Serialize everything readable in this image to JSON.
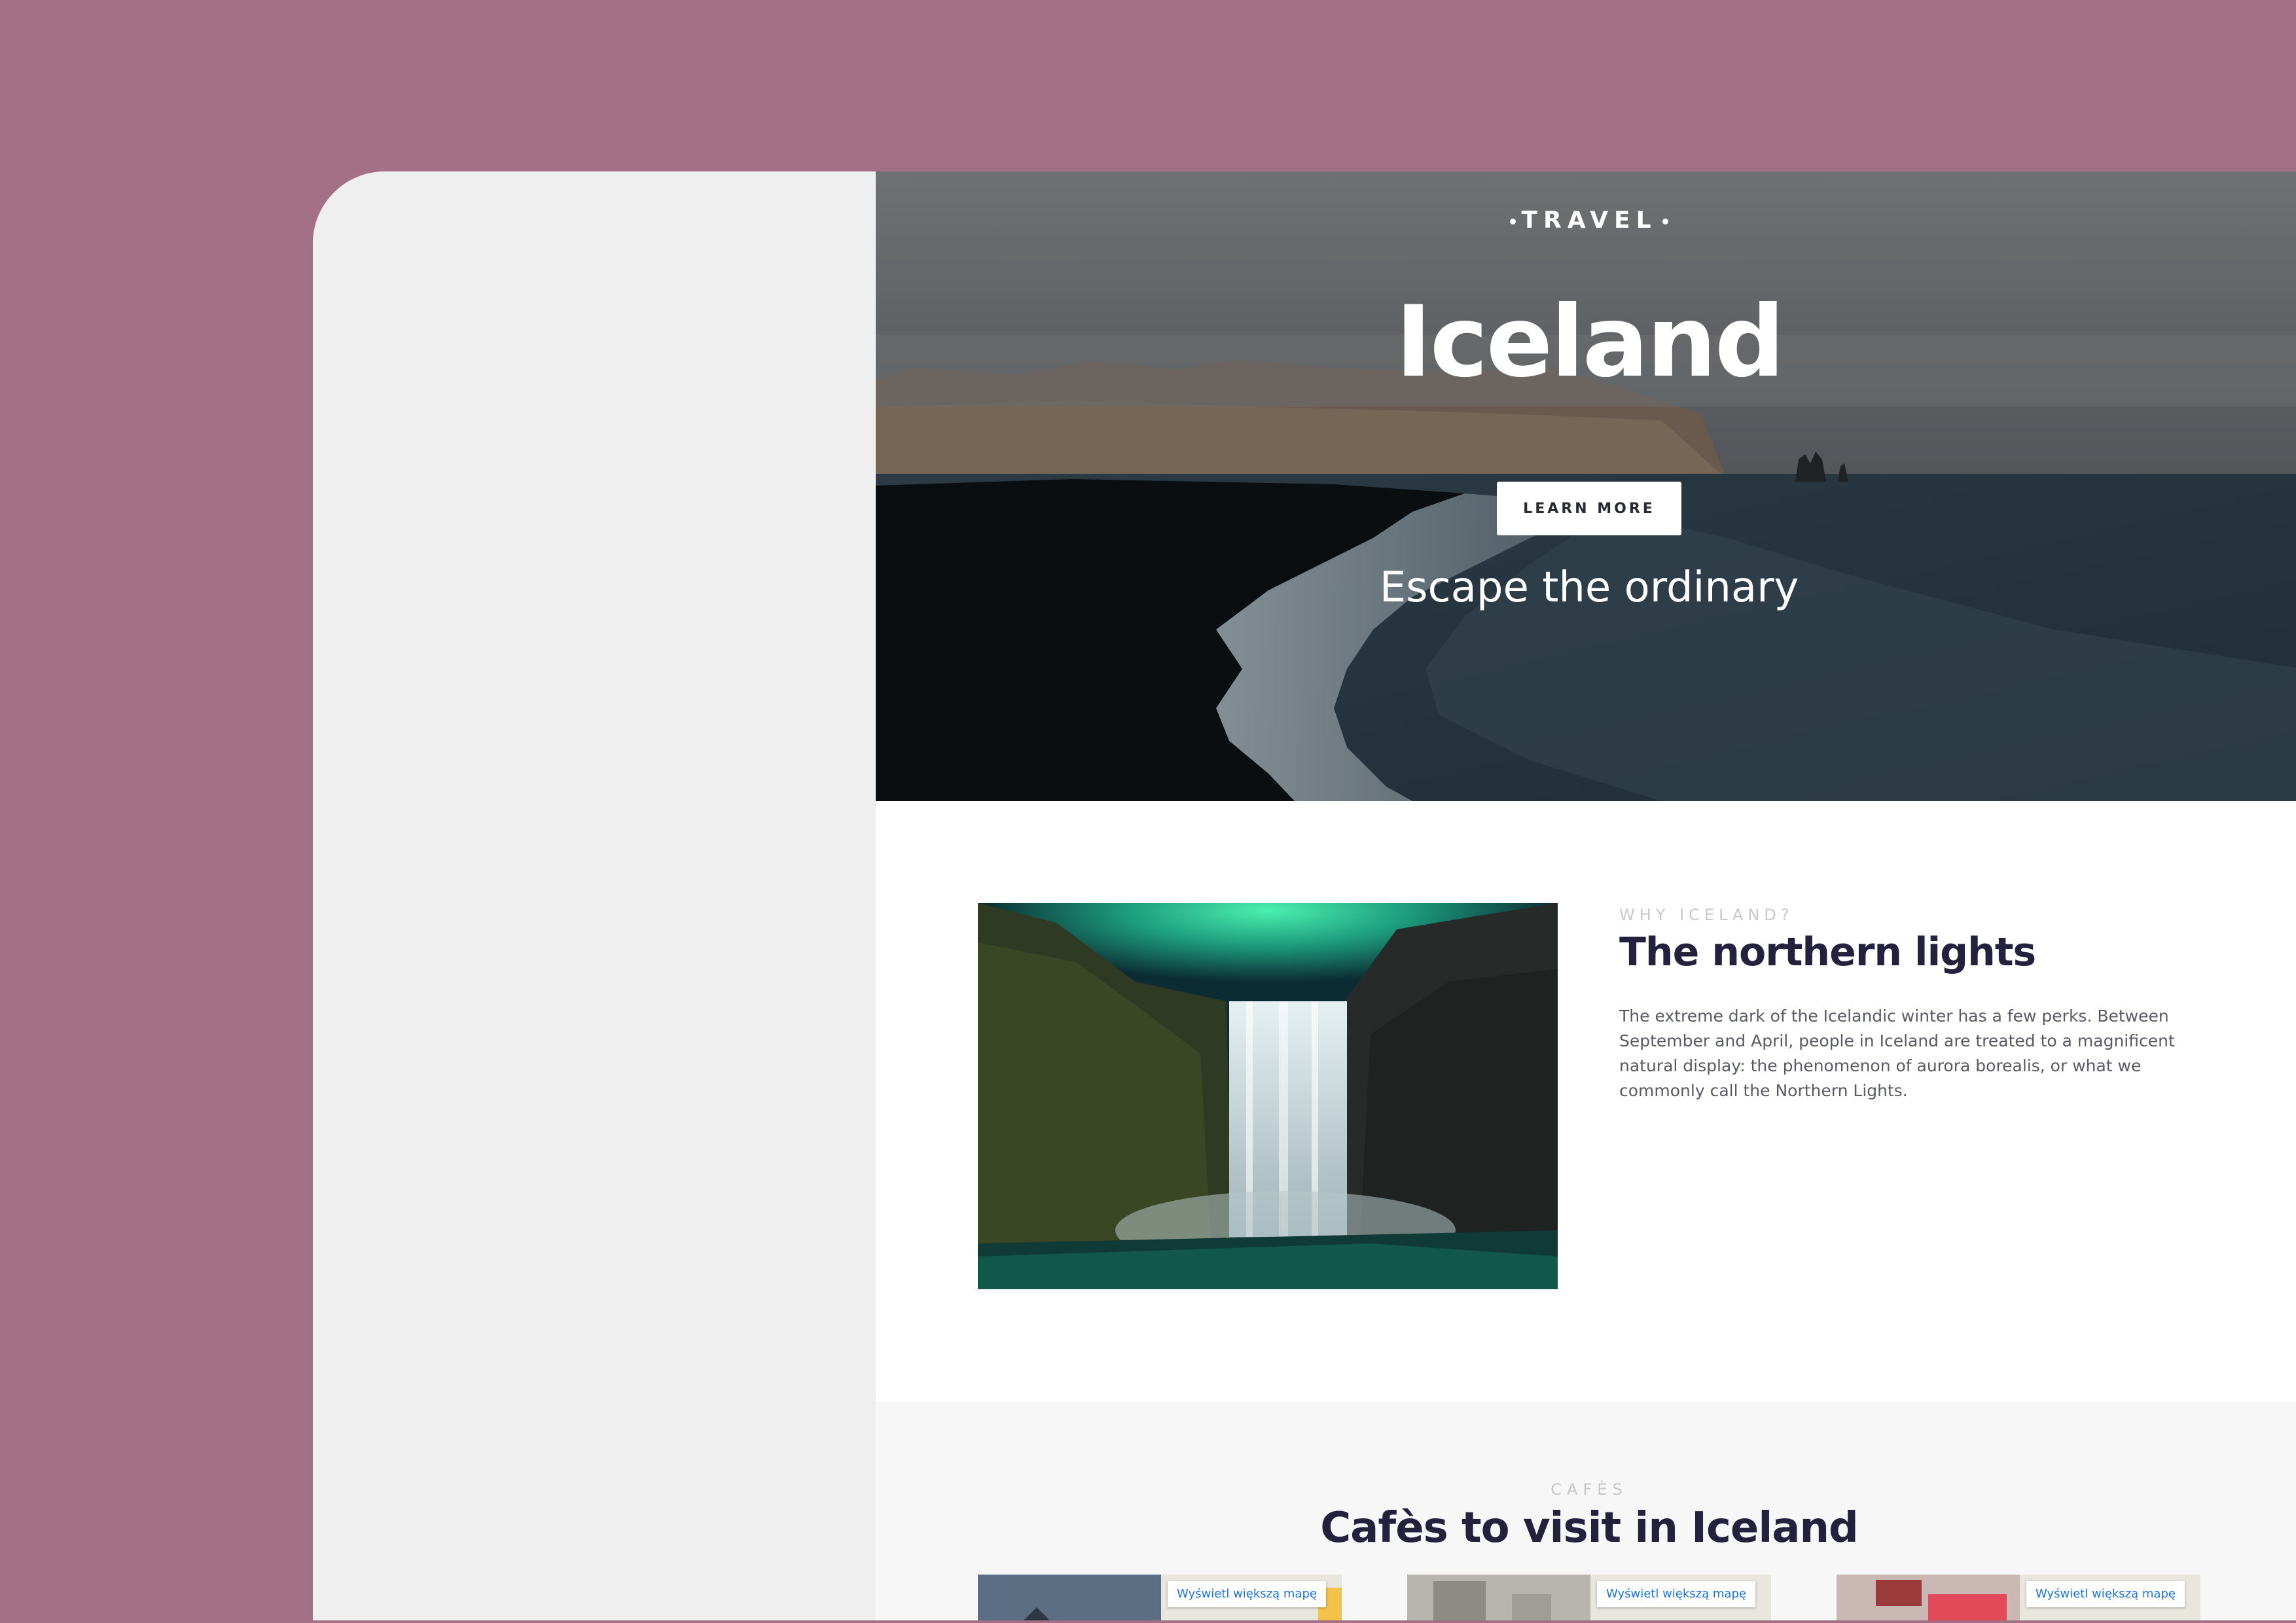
{
  "colors": {
    "backdrop": "#a37085",
    "panel": "#efefef",
    "heading": "#24213f",
    "muted": "#c7c7cc",
    "map_link": "#1a73e8"
  },
  "hero": {
    "kicker": "TRAVEL",
    "title": "Iceland",
    "subtitle": "Escape the ordinary",
    "button_label": "LEARN MORE"
  },
  "feature": {
    "kicker": "WHY ICELAND?",
    "title": "The northern lights",
    "text": "The extreme dark of the Icelandic winter has a few perks. Between September and April, people in Iceland are treated to a magnificent natural display: the phenomenon of aurora borealis, or what we commonly call the Northern Lights.",
    "image_icon": "waterfall-aurora-photo"
  },
  "cafes": {
    "kicker": "CAFÈS",
    "title": "Cafès to visit in Iceland",
    "maps": [
      {
        "button_label": "Wyświetl większą mapę"
      },
      {
        "button_label": "Wyświetl większą mapę"
      },
      {
        "button_label": "Wyświetl większą mapę"
      }
    ]
  }
}
